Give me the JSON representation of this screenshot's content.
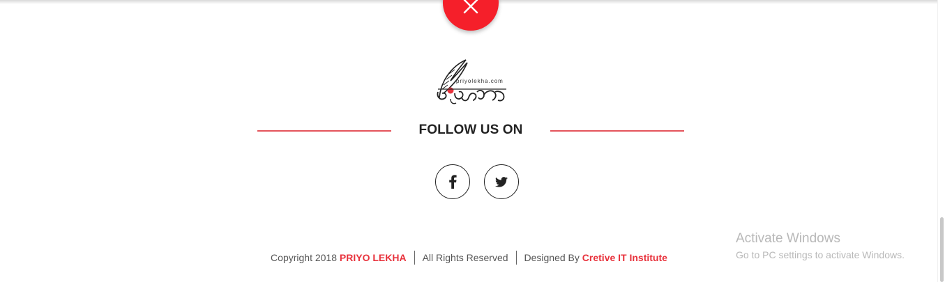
{
  "close_button": {
    "icon": "close-icon",
    "color": "#f51f2a"
  },
  "logo": {
    "tagline": "priyolekha.com",
    "wordmark": "প্রিয়লেখা"
  },
  "follow": {
    "title": "FOLLOW US ON",
    "line_color": "#e4545b"
  },
  "social": [
    {
      "name": "facebook",
      "icon": "facebook-icon"
    },
    {
      "name": "twitter",
      "icon": "twitter-icon"
    }
  ],
  "footer": {
    "copyright_prefix": "Copyright 2018",
    "brand": "PRIYO LEKHA",
    "rights": "All Rights Reserved",
    "designed_prefix": "Designed By",
    "designer": "Cretive IT Institute",
    "accent_color": "#e8323c"
  },
  "activation": {
    "title": "Activate Windows",
    "subtitle": "Go to PC settings to activate Windows."
  }
}
